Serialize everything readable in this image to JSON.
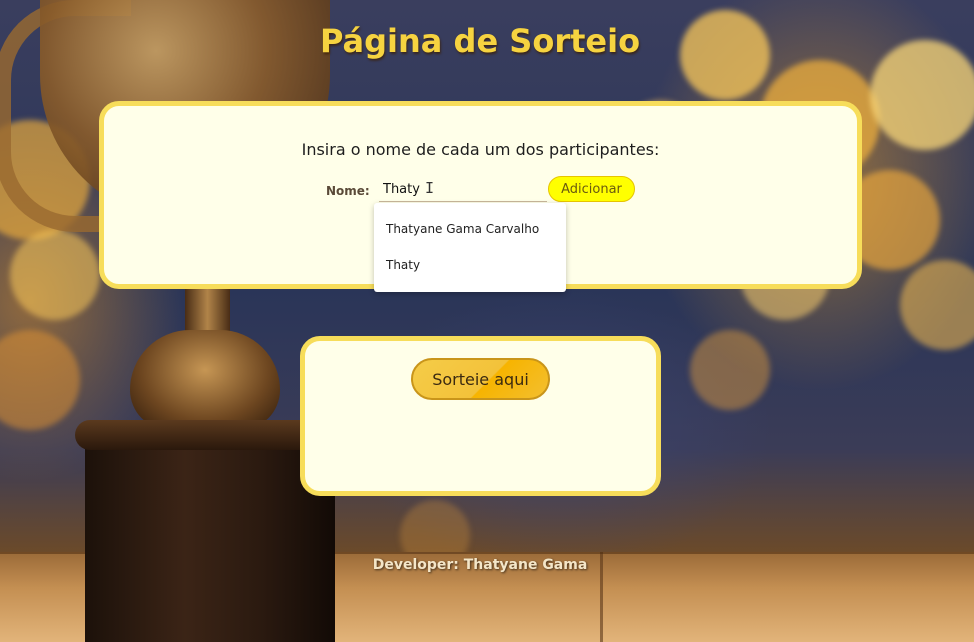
{
  "page": {
    "title": "Página de Sorteio",
    "footer": "Developer: Thatyane Gama"
  },
  "form": {
    "instruction": "Insira o nome de cada um dos participantes:",
    "name_label": "Nome:",
    "name_value": "Thaty",
    "add_button": "Adicionar"
  },
  "autocomplete": {
    "suggestions": [
      "Thatyane Gama Carvalho",
      "Thaty"
    ]
  },
  "draw": {
    "button": "Sorteie aqui"
  },
  "colors": {
    "title": "#f6d340",
    "panel_bg": "#ffffe9",
    "panel_border": "#f7dd5a",
    "add_button": "#ffff00",
    "draw_button": "#f3c23a"
  },
  "icons": {
    "cursor": "text-cursor-icon"
  }
}
